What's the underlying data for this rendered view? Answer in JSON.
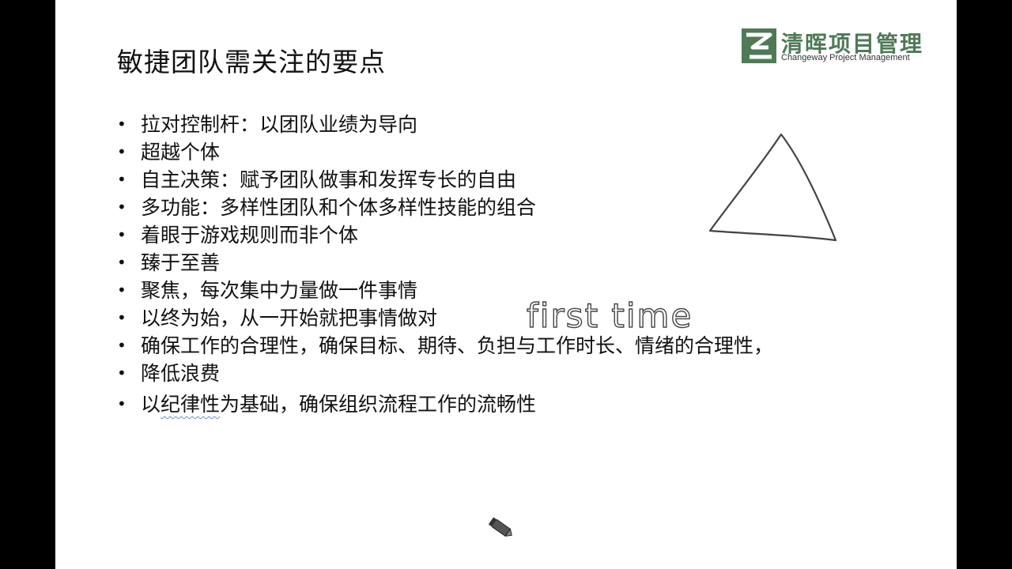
{
  "slide": {
    "title": "敏捷团队需关注的要点",
    "logo": {
      "cn": "清晖项目管理",
      "en": "Changeway Project Management"
    },
    "bullets": [
      "拉对控制杆：以团队业绩为导向",
      "超越个体",
      "自主决策：赋予团队做事和发挥专长的自由",
      "多功能：多样性团队和个体多样性技能的组合",
      "着眼于游戏规则而非个体",
      "臻于至善",
      "聚焦，每次集中力量做一件事情",
      "以终为始，从一开始就把事情做对",
      "确保工作的合理性，确保目标、期待、负担与工作时长、情绪的合理性，",
      "降低浪费"
    ],
    "last_bullet": {
      "before": "以",
      "underlined": "纪律性",
      "after": "为基础，确保组织流程工作的流畅性"
    },
    "annotation": "first time"
  },
  "colors": {
    "logo_green": "#4e7a56",
    "ink": "#444444",
    "squiggle": "#6b8fc9"
  },
  "icons": {
    "pen": "pen-cursor-icon",
    "triangle": "triangle-sketch-icon"
  }
}
